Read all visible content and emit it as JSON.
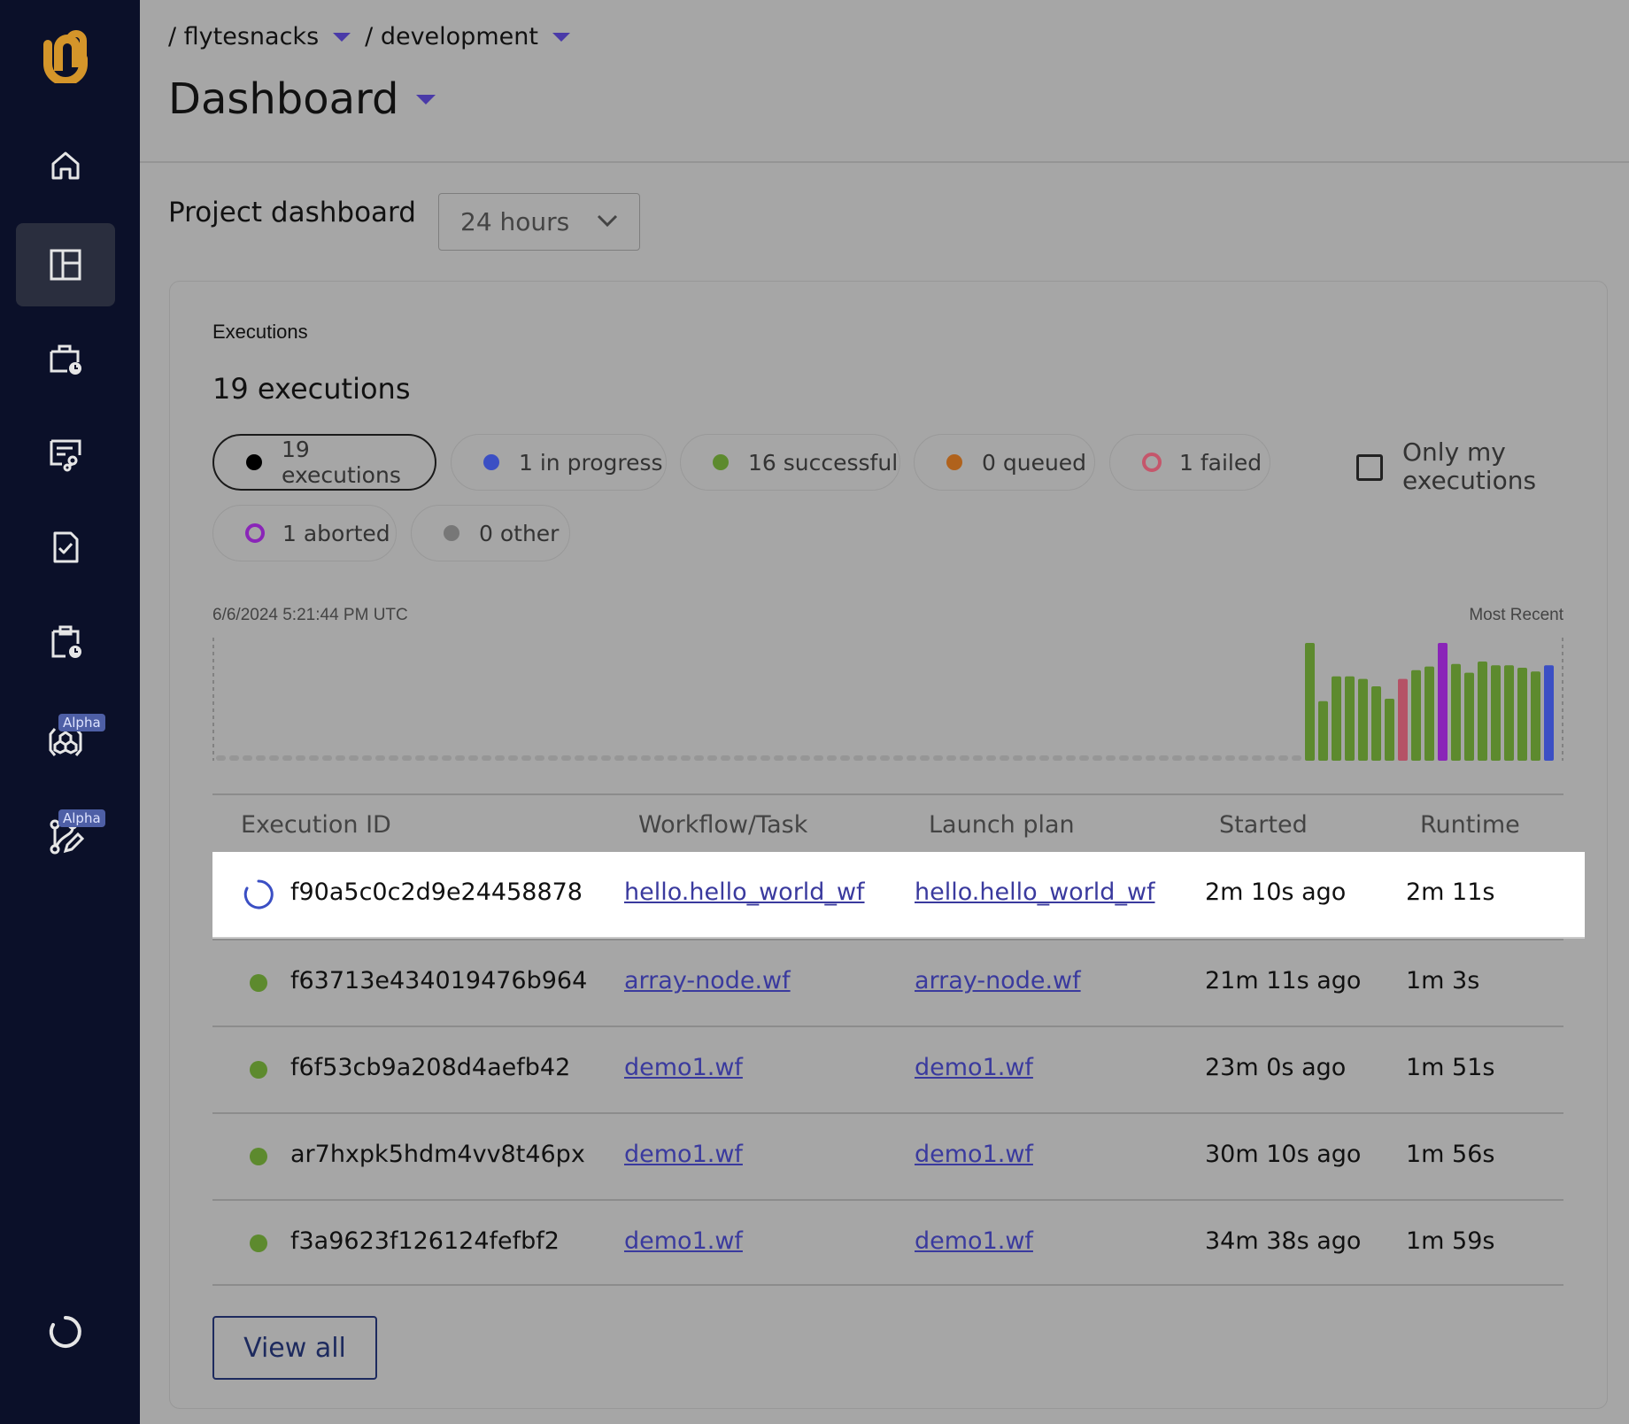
{
  "breadcrumb": {
    "project": "/ flytesnacks",
    "domain": "/ development"
  },
  "page": {
    "title": "Dashboard"
  },
  "dashboard": {
    "label": "Project dashboard",
    "timeframe": "24 hours"
  },
  "executions": {
    "heading": "Executions",
    "count_label": "19 executions",
    "filters": [
      {
        "label": "19 executions",
        "color": "#000000",
        "style": "dot",
        "selected": true
      },
      {
        "label": "1 in progress",
        "color": "#3b4fc4",
        "style": "dot"
      },
      {
        "label": "16 successful",
        "color": "#5d8a2e",
        "style": "dot"
      },
      {
        "label": "0 queued",
        "color": "#b0621c",
        "style": "dot"
      },
      {
        "label": "1 failed",
        "color": "#c5566b",
        "style": "ring"
      },
      {
        "label": "1 aborted",
        "color": "#8a25b8",
        "style": "ring"
      },
      {
        "label": "0 other",
        "color": "#777777",
        "style": "dot"
      }
    ],
    "only_mine_label": "Only my executions"
  },
  "chart": {
    "start_label": "6/6/2024 5:21:44 PM UTC",
    "end_label": "Most Recent"
  },
  "chart_data": {
    "type": "bar",
    "placeholder_slots": 82,
    "series": [
      {
        "status": "successful",
        "value": 95,
        "color": "#5d8a2e"
      },
      {
        "status": "successful",
        "value": 48,
        "color": "#5d8a2e"
      },
      {
        "status": "successful",
        "value": 68,
        "color": "#5d8a2e"
      },
      {
        "status": "successful",
        "value": 68,
        "color": "#5d8a2e"
      },
      {
        "status": "successful",
        "value": 66,
        "color": "#5d8a2e"
      },
      {
        "status": "successful",
        "value": 60,
        "color": "#5d8a2e"
      },
      {
        "status": "successful",
        "value": 50,
        "color": "#5d8a2e"
      },
      {
        "status": "failed",
        "value": 66,
        "color": "#b55266"
      },
      {
        "status": "successful",
        "value": 73,
        "color": "#5d8a2e"
      },
      {
        "status": "successful",
        "value": 76,
        "color": "#5d8a2e"
      },
      {
        "status": "aborted",
        "value": 95,
        "color": "#8a25b8"
      },
      {
        "status": "successful",
        "value": 78,
        "color": "#5d8a2e"
      },
      {
        "status": "successful",
        "value": 71,
        "color": "#5d8a2e"
      },
      {
        "status": "successful",
        "value": 80,
        "color": "#5d8a2e"
      },
      {
        "status": "successful",
        "value": 77,
        "color": "#5d8a2e"
      },
      {
        "status": "successful",
        "value": 77,
        "color": "#5d8a2e"
      },
      {
        "status": "successful",
        "value": 75,
        "color": "#5d8a2e"
      },
      {
        "status": "successful",
        "value": 72,
        "color": "#5d8a2e"
      },
      {
        "status": "in_progress",
        "value": 77,
        "color": "#3b4fc4"
      }
    ],
    "ylim": [
      0,
      100
    ]
  },
  "table": {
    "headers": [
      "Execution ID",
      "Workflow/Task",
      "Launch plan",
      "Started",
      "Runtime"
    ],
    "rows": [
      {
        "id": "f90a5c0c2d9e24458878",
        "workflow": "hello.hello_world_wf",
        "launch_plan": "hello.hello_world_wf",
        "started": "2m 10s ago",
        "runtime": "2m 11s",
        "status": "running"
      },
      {
        "id": "f63713e434019476b964",
        "workflow": "array-node.wf",
        "launch_plan": "array-node.wf",
        "started": "21m 11s ago",
        "runtime": "1m 3s",
        "status": "succeeded"
      },
      {
        "id": "f6f53cb9a208d4aefb42",
        "workflow": "demo1.wf",
        "launch_plan": "demo1.wf",
        "started": "23m 0s ago",
        "runtime": "1m 51s",
        "status": "succeeded"
      },
      {
        "id": "ar7hxpk5hdm4vv8t46px",
        "workflow": "demo1.wf",
        "launch_plan": "demo1.wf",
        "started": "30m 10s ago",
        "runtime": "1m 56s",
        "status": "succeeded"
      },
      {
        "id": "f3a9623f126124fefbf2",
        "workflow": "demo1.wf",
        "launch_plan": "demo1.wf",
        "started": "34m 38s ago",
        "runtime": "1m 59s",
        "status": "succeeded"
      }
    ]
  },
  "view_all_label": "View all",
  "sidebar": {
    "items": [
      {
        "icon": "home-icon"
      },
      {
        "icon": "dashboard-icon",
        "active": true
      },
      {
        "icon": "briefcase-clock-icon"
      },
      {
        "icon": "workflow-icon"
      },
      {
        "icon": "task-check-icon"
      },
      {
        "icon": "clipboard-clock-icon"
      },
      {
        "icon": "cubes-icon",
        "badge": "Alpha"
      },
      {
        "icon": "git-edit-icon",
        "badge": "Alpha"
      },
      {
        "icon": "loading-circle-icon"
      }
    ]
  },
  "colors": {
    "sidebar_bg": "#0b1029",
    "logo": "#d4952a",
    "link": "#3a3a9e",
    "accent": "#4a3aa8"
  }
}
